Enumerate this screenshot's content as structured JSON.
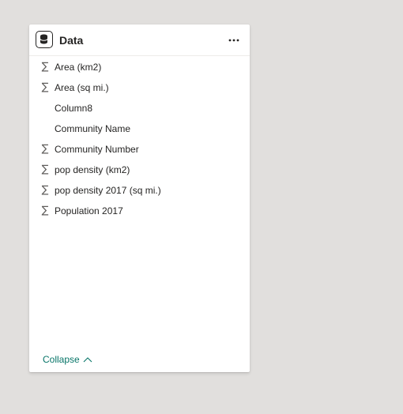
{
  "panel": {
    "title": "Data",
    "more_options_icon": "ellipsis-icon",
    "table_icon": "table-icon"
  },
  "fields": [
    {
      "label": "Area (km2)",
      "summable": true
    },
    {
      "label": "Area (sq mi.)",
      "summable": true
    },
    {
      "label": "Column8",
      "summable": false
    },
    {
      "label": "Community Name",
      "summable": false
    },
    {
      "label": "Community Number",
      "summable": true
    },
    {
      "label": "pop density (km2)",
      "summable": true
    },
    {
      "label": "pop density 2017 (sq mi.)",
      "summable": true
    },
    {
      "label": "Population 2017",
      "summable": true
    }
  ],
  "sigma_glyph": "∑",
  "footer": {
    "collapse_label": "Collapse",
    "collapse_icon": "chevron-up-icon"
  },
  "colors": {
    "background": "#e1dfdd",
    "card": "#ffffff",
    "text": "#252423",
    "link": "#077568"
  }
}
